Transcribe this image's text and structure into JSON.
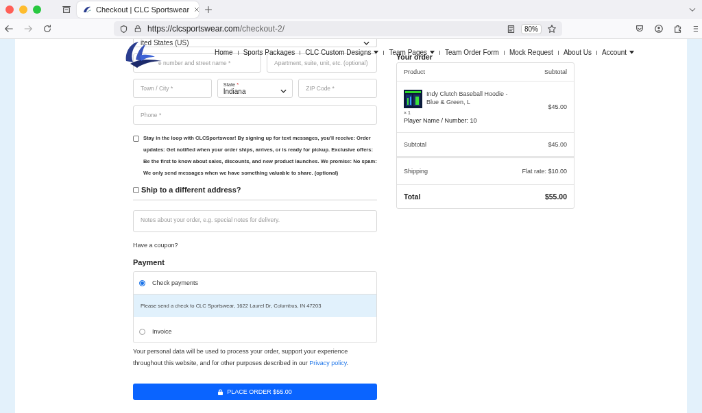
{
  "browser": {
    "tab_title": "Checkout | CLC Sportswear",
    "url_host": "https://clcsportswear.com",
    "url_path": "/checkout-2/",
    "zoom": "80%"
  },
  "nav": [
    {
      "label": "Home",
      "dropdown": false
    },
    {
      "label": "Sports Packages",
      "dropdown": false
    },
    {
      "label": "CLC Custom Designs",
      "dropdown": true
    },
    {
      "label": "Team Pages",
      "dropdown": true
    },
    {
      "label": "Team Order Form",
      "dropdown": false
    },
    {
      "label": "Mock Request",
      "dropdown": false
    },
    {
      "label": "About Us",
      "dropdown": false
    },
    {
      "label": "Account",
      "dropdown": true
    }
  ],
  "billing": {
    "country": "ited States (US)",
    "street_placeholder": "e number and street name *",
    "apartment_placeholder": "Apartment, suite, unit, etc. (optional)",
    "city_placeholder": "Town / City *",
    "state_label": "State",
    "state_required": "*",
    "state_value": "Indiana",
    "zip_placeholder": "ZIP Code *",
    "phone_placeholder": "Phone *"
  },
  "sms_optin": {
    "checked": false,
    "text": "Stay in the loop with CLCSportswear! By signing up for text messages, you'll receive: Order updates: Get notified when your order ships, arrives, or is ready for pickup. Exclusive offers: Be the first to know about sales, discounts, and new product launches. We promise: No spam: We only send messages when we have something valuable to share. (optional)"
  },
  "ship_different": {
    "checked": false,
    "label": "Ship to a different address?"
  },
  "notes_placeholder": "Notes about your order, e.g. special notes for delivery.",
  "coupon": "Have a coupon?",
  "payment": {
    "title": "Payment",
    "methods": [
      {
        "label": "Check payments",
        "selected": true,
        "description": "Please send a check to CLC Sportswear, 1622 Laurel Dr, Columbus, IN 47203"
      },
      {
        "label": "Invoice",
        "selected": false
      }
    ]
  },
  "privacy": {
    "text": "Your personal data will be used to process your order, support your experience throughout this website, and for other purposes described in our ",
    "link": "Privacy policy",
    "end": "."
  },
  "place_order": "PLACE ORDER $55.00",
  "order": {
    "title": "Your order",
    "columns": [
      "Product",
      "Subtotal"
    ],
    "item": {
      "name": "Indy Clutch Baseball Hoodie - Blue & Green, L",
      "qty": "× 1",
      "meta_label": "Player Name / Number:",
      "meta_value": "10",
      "price": "$45.00"
    },
    "subtotal": {
      "label": "Subtotal",
      "value": "$45.00"
    },
    "shipping": {
      "label": "Shipping",
      "value": "Flat rate: $10.00"
    },
    "total": {
      "label": "Total",
      "value": "$55.00"
    }
  }
}
